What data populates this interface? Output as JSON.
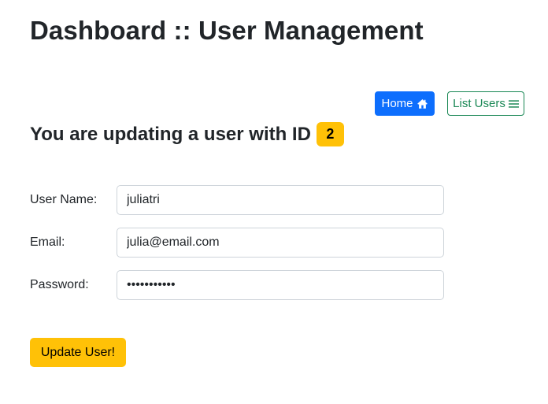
{
  "header": {
    "title": "Dashboard :: User Management"
  },
  "nav": {
    "home_label": "Home",
    "home_icon": "house-icon",
    "list_users_label": "List Users",
    "list_users_icon": "list-icon"
  },
  "subtitle": {
    "text": "You are updating a user with ID",
    "user_id": "2"
  },
  "form": {
    "username": {
      "label": "User Name:",
      "value": "juliatri"
    },
    "email": {
      "label": "Email:",
      "value": "julia@email.com"
    },
    "password": {
      "label": "Password:",
      "value": "juliatri123"
    },
    "submit_label": "Update User!"
  },
  "colors": {
    "primary": "#0d6efd",
    "success": "#198754",
    "warning": "#ffc107",
    "text": "#212529"
  }
}
